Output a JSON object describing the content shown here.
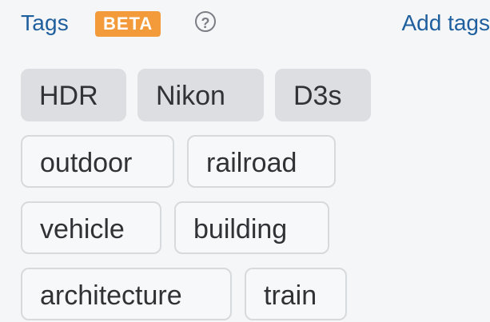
{
  "header": {
    "title": "Tags",
    "badge": "BETA",
    "help_glyph": "?",
    "add_label": "Add tags"
  },
  "tags": {
    "row1": [
      "HDR",
      "Nikon",
      "D3s"
    ],
    "row2": [
      "outdoor",
      "railroad"
    ],
    "row3": [
      "vehicle",
      "building"
    ],
    "row4": [
      "architecture",
      "train"
    ]
  },
  "styles": {
    "accent": "#1f5f9e",
    "badge_bg": "#f39a3a"
  }
}
